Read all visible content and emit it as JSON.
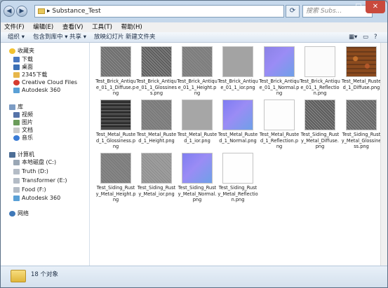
{
  "window": {
    "address_crumb": "Substance_Test",
    "search_placeholder": "搜索 Subs...",
    "minimize": "–",
    "maximize": "□",
    "close": "✕"
  },
  "menu": [
    "文件(F)",
    "编辑(E)",
    "查看(V)",
    "工具(T)",
    "帮助(H)"
  ],
  "toolbar": {
    "organize": "组织 ▾",
    "include": "包含到库中 ▾",
    "share": "共享 ▾",
    "slideshow": "放映幻灯片",
    "newfolder": "新建文件夹"
  },
  "sidebar": {
    "favorites": "收藏夹",
    "downloads": "下载",
    "desktop": "桌面",
    "recent": "2345下载",
    "ccfiles": "Creative Cloud Files",
    "autodesk1": "Autodesk 360",
    "libraries": "库",
    "videos": "视频",
    "pictures": "图片",
    "documents": "文档",
    "music": "音乐",
    "computer": "计算机",
    "disk_c": "本地磁盘 (C:)",
    "disk_d": "Truth (D:)",
    "disk_e": "Transformer (E:)",
    "disk_f": "Food (F:)",
    "autodesk2": "Autodesk 360",
    "network": "网络"
  },
  "files": [
    {
      "name": "Test_Brick_Antique_01_1_Diffuse.png",
      "color": "#6f6f6f",
      "kind": "noise"
    },
    {
      "name": "Test_Brick_Antique_01_1_Glossiness.png",
      "color": "#5e5e5e",
      "kind": "noise"
    },
    {
      "name": "Test_Brick_Antique_01_1_Height.png",
      "color": "#7d7d7d",
      "kind": "noise"
    },
    {
      "name": "Test_Brick_Antique_01_1_ior.png",
      "color": "#a3a3a3",
      "kind": "flat"
    },
    {
      "name": "Test_Brick_Antique_01_1_Normal.png",
      "color": "#8b82e6",
      "kind": "normal"
    },
    {
      "name": "Test_Brick_Antique_01_1_Reflection.png",
      "color": "#fbfbfb",
      "kind": "flat"
    },
    {
      "name": "Test_Metal_Rusted_1_Diffuse.png",
      "color": "#8a4a1e",
      "kind": "rust"
    },
    {
      "name": "Test_Metal_Rusted_1_Glossiness.png",
      "color": "#3d3d3d",
      "kind": "metal"
    },
    {
      "name": "Test_Metal_Rusted_1_Height.png",
      "color": "#7a7a7a",
      "kind": "noise"
    },
    {
      "name": "Test_Metal_Rusted_1_ior.png",
      "color": "#a6a6a6",
      "kind": "flat"
    },
    {
      "name": "Test_Metal_Rusted_1_Normal.png",
      "color": "#7e7cf2",
      "kind": "normal"
    },
    {
      "name": "Test_Metal_Rusted_1_Reflection.png",
      "color": "#fdfdfd",
      "kind": "flat"
    },
    {
      "name": "Test_Siding_Rusty_Metal_Diffuse.png",
      "color": "#5c5c5c",
      "kind": "noise"
    },
    {
      "name": "Test_Siding_Rusty_Metal_Glossiness.png",
      "color": "#676767",
      "kind": "noise"
    },
    {
      "name": "Test_Siding_Rusty_Metal_Height.png",
      "color": "#7c7c7c",
      "kind": "noise"
    },
    {
      "name": "Test_Siding_Rusty_Metal_ior.png",
      "color": "#9e9e9e",
      "kind": "noise"
    },
    {
      "name": "Test_Siding_Rusty_Metal_Normal.png",
      "color": "#7f7ef0",
      "kind": "normal"
    },
    {
      "name": "Test_Siding_Rusty_Metal_Reflection.png",
      "color": "#fefefe",
      "kind": "flat"
    }
  ],
  "status": {
    "count": "18 个对象"
  }
}
